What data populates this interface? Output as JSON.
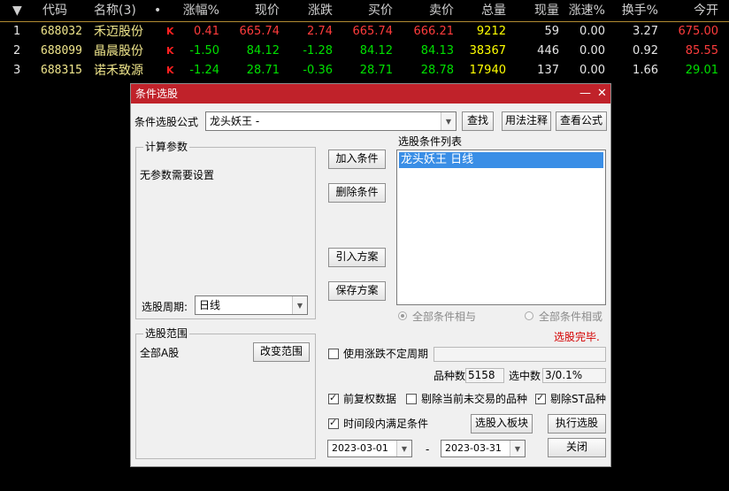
{
  "table": {
    "headers": {
      "sort": "▼",
      "code": "代码",
      "name": "名称(3)",
      "dot": "•",
      "chg": "涨幅%",
      "price": "现价",
      "diff": "涨跌",
      "bid": "买价",
      "ask": "卖价",
      "vol": "总量",
      "cur": "现量",
      "spd": "涨速%",
      "turn": "换手%",
      "open": "今开"
    },
    "rows": [
      {
        "idx": "1",
        "code": "688032",
        "name": "禾迈股份",
        "k": "K",
        "chg": "0.41",
        "price": "665.74",
        "diff": "2.74",
        "bid": "665.74",
        "ask": "666.21",
        "vol": "9212",
        "cur": "59",
        "spd": "0.00",
        "turn": "3.27",
        "open": "675.00"
      },
      {
        "idx": "2",
        "code": "688099",
        "name": "晶晨股份",
        "k": "K",
        "chg": "-1.50",
        "price": "84.12",
        "diff": "-1.28",
        "bid": "84.12",
        "ask": "84.13",
        "vol": "38367",
        "cur": "446",
        "spd": "0.00",
        "turn": "0.92",
        "open": "85.55"
      },
      {
        "idx": "3",
        "code": "688315",
        "name": "诺禾致源",
        "k": "K",
        "chg": "-1.24",
        "price": "28.71",
        "diff": "-0.36",
        "bid": "28.71",
        "ask": "28.78",
        "vol": "17940",
        "cur": "137",
        "spd": "0.00",
        "turn": "1.66",
        "open": "29.01"
      }
    ]
  },
  "dialog": {
    "title": "条件选股",
    "minimize": "—",
    "close_x": "✕",
    "formula_label": "条件选股公式",
    "formula_value": "龙头妖王      -",
    "btn_search": "查找",
    "btn_usage": "用法注释",
    "btn_view": "查看公式",
    "calc_params_title": "计算参数",
    "no_params": "无参数需要设置",
    "period_label": "选股周期:",
    "period_value": "日线",
    "btn_add": "加入条件",
    "btn_delete": "删除条件",
    "btn_import": "引入方案",
    "btn_save": "保存方案",
    "cond_list_title": "选股条件列表",
    "cond_items": [
      "龙头妖王  日线"
    ],
    "radio_and": "全部条件相与",
    "radio_or": "全部条件相或",
    "status": "选股完毕.",
    "range_title": "选股范围",
    "range_value": "全部A股",
    "btn_change_range": "改变范围",
    "uncertain_period": "使用涨跌不定周期",
    "count_label": "品种数",
    "count_value": "5158",
    "selected_label": "选中数",
    "selected_value": "3/0.1%",
    "chk_prerights": "前复权数据",
    "chk_exclude_untraded": "剔除当前未交易的品种",
    "chk_exclude_st": "剔除ST品种",
    "chk_time_range": "时间段内满足条件",
    "btn_to_board": "选股入板块",
    "btn_execute": "执行选股",
    "date_from": "2023-03-01",
    "date_sep": "-",
    "date_to": "2023-03-31",
    "btn_close": "关闭"
  },
  "colors": {
    "up": "#ff3c3c",
    "down": "#00e000",
    "title_bar": "#c0222a",
    "selection": "#3a8ee6"
  }
}
